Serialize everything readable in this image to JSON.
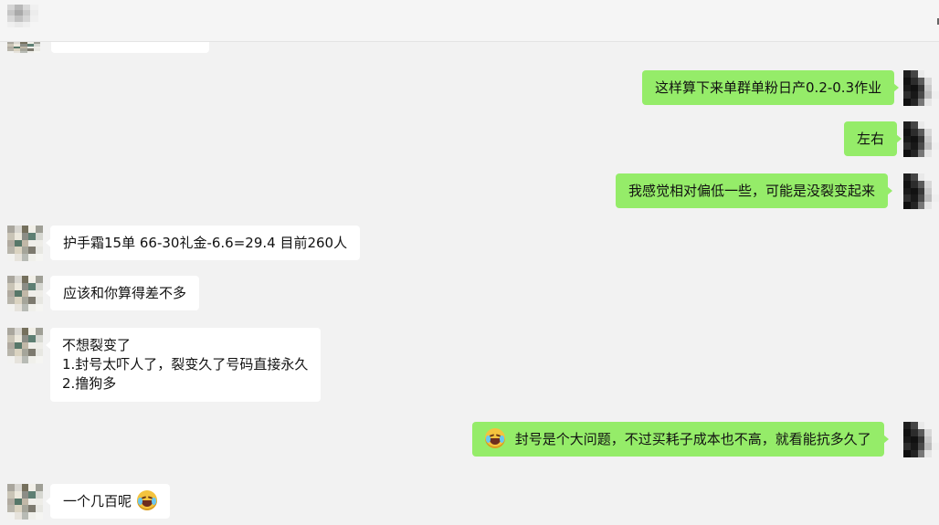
{
  "window": {
    "colors": {
      "background": "#f2f2f2",
      "self_bubble": "#95ec69",
      "other_bubble": "#ffffff",
      "text": "#111111"
    }
  },
  "avatars": {
    "contact_palette": [
      "#a9a69d",
      "#d8d6d0",
      "#75705d",
      "#f1efe8",
      "#9f9f96",
      "#c9c4b6",
      "#ece8dc",
      "#8c8d86",
      "#5e7f73",
      "#d6d7d1",
      "#b0aaa0",
      "#577769",
      "#c1b8a8",
      "#efeee9",
      "#eeede8",
      "#b8b5ab",
      "#dad3c1",
      "#a5a59a",
      "#7d7a6f",
      "#e7e7e2",
      "#f2f2f0",
      "#e6e3dc",
      "#b8bbb5",
      "#f0f0eb",
      "#f5f5f2"
    ],
    "self_palette": [
      "#1f1f1f",
      "#454545",
      "#e9e9e9",
      "#f2f2f2",
      "#f2f2f2",
      "#121212",
      "#2c2c2c",
      "#5b5b5b",
      "#d7d7d7",
      "#f2f2f2",
      "#1a1a1a",
      "#111111",
      "#383838",
      "#c9c9c9",
      "#f2f2f2",
      "#2d2d2d",
      "#181818",
      "#4a4a4a",
      "#bdbdbd",
      "#eeeeee",
      "#0f0f0f",
      "#242424",
      "#777777",
      "#e5e5e5",
      "#f2f2f2"
    ],
    "top_palette": [
      "#d5d5d5",
      "#b8b8b8",
      "#d9d9d9",
      "#f0f0f0",
      "#f5f5f5",
      "#c6c6c6",
      "#a9a9a9",
      "#cacaca",
      "#ececec",
      "#f5f5f5",
      "#d8d8d8",
      "#c1c1c1",
      "#d6d6d6",
      "#f0f0f0",
      "#f5f5f5",
      "#efefef",
      "#e9e9e9",
      "#efefef",
      "#f5f5f5",
      "#f5f5f5",
      "#f5f5f5",
      "#f5f5f5",
      "#f5f5f5",
      "#f5f5f5",
      "#f5f5f5"
    ]
  },
  "messages": [
    {
      "text": "这样算下来单群单粉日产0.2-0.3作业"
    },
    {
      "text": "左右"
    },
    {
      "text": "我感觉相对偏低一些，可能是没裂变起来"
    },
    {
      "text": "护手霜15单 66-30礼金-6.6=29.4 目前260人"
    },
    {
      "text": "应该和你算得差不多"
    },
    {
      "lines": [
        "不想裂变了",
        "1.封号太吓人了，裂变久了号码直接永久",
        "2.撸狗多"
      ]
    },
    {
      "emoji": "rolling-laughing-emoji",
      "text": "封号是个大问题，不过买耗子成本也不高，就看能抗多久了"
    },
    {
      "text": "一个几百呢",
      "emoji": "laughing-tears-emoji"
    }
  ]
}
